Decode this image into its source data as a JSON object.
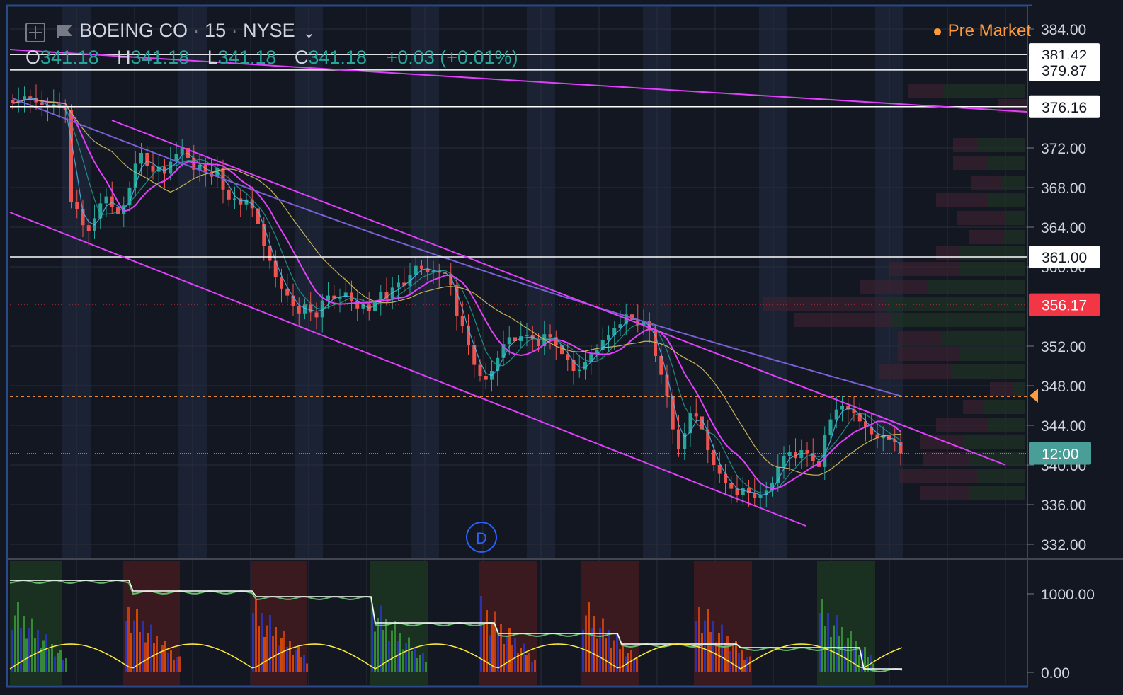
{
  "header": {
    "symbol": "BOEING CO",
    "interval": "15",
    "exchange": "NYSE",
    "session_label": "Pre Market"
  },
  "ohlc": {
    "o_label": "O",
    "o": "341.18",
    "h_label": "H",
    "h": "341.18",
    "l_label": "L",
    "l": "341.18",
    "c_label": "C",
    "c": "341.18",
    "change": "+0.03 (+0.01%)"
  },
  "price_scale": {
    "ticks": [
      "384.00",
      "372.00",
      "368.00",
      "364.00",
      "360.00",
      "352.00",
      "348.00",
      "344.00",
      "340.00",
      "336.00",
      "332.00"
    ],
    "labels": [
      {
        "text": "381.42",
        "kind": "level"
      },
      {
        "text": "379.87",
        "kind": "level"
      },
      {
        "text": "376.16",
        "kind": "level"
      },
      {
        "text": "361.00",
        "kind": "level"
      },
      {
        "text": "356.17",
        "kind": "last"
      },
      {
        "text": "12:00",
        "kind": "countdown"
      }
    ]
  },
  "indicator_scale": {
    "ticks": [
      "1000.00",
      "0.00"
    ]
  },
  "event_badge": "D",
  "colors": {
    "background": "#131722",
    "up": "#26a69a",
    "down": "#ef5350",
    "channel": "#e040fb",
    "ma_long": "#7b5fd6",
    "ma_mid": "#c9b35a",
    "level_line": "#ffffff",
    "last_price": "#f23645",
    "countdown": "#4a9e98",
    "premarket": "#ff9b3d"
  },
  "chart_data": {
    "type": "candlestick",
    "title": "BOEING CO · 15 · NYSE",
    "ylim": [
      330.0,
      385.0
    ],
    "closes": [
      376.5,
      376.8,
      377.2,
      377.0,
      376.6,
      376.3,
      376.1,
      376.4,
      376.0,
      375.8,
      366.5,
      365.8,
      364.2,
      363.6,
      364.9,
      366.4,
      367.1,
      366.0,
      365.3,
      366.2,
      368.0,
      370.4,
      371.5,
      370.2,
      369.6,
      370.1,
      369.4,
      370.6,
      371.4,
      372.0,
      371.0,
      369.8,
      370.3,
      369.6,
      369.1,
      370.0,
      367.8,
      366.8,
      366.9,
      366.3,
      366.8,
      365.9,
      364.3,
      362.1,
      360.6,
      359.0,
      357.8,
      357.1,
      356.0,
      355.3,
      356.2,
      355.4,
      354.9,
      356.6,
      357.1,
      356.8,
      357.0,
      357.4,
      356.5,
      355.8,
      356.2,
      355.5,
      356.6,
      357.5,
      356.8,
      357.9,
      358.4,
      358.1,
      359.2,
      360.1,
      359.8,
      359.5,
      359.6,
      359.4,
      359.3,
      358.2,
      355.0,
      354.0,
      352.1,
      350.1,
      349.0,
      348.6,
      349.5,
      350.8,
      352.2,
      352.9,
      352.5,
      353.0,
      353.1,
      352.7,
      352.0,
      353.2,
      352.9,
      352.1,
      351.2,
      350.6,
      349.5,
      349.6,
      350.4,
      351.2,
      351.6,
      352.6,
      353.1,
      353.8,
      354.2,
      355.2,
      354.7,
      354.1,
      354.5,
      353.6,
      351.0,
      349.1,
      347.0,
      343.6,
      341.6,
      343.2,
      345.2,
      344.9,
      343.6,
      341.5,
      340.0,
      339.1,
      338.2,
      337.6,
      337.0,
      337.7,
      337.2,
      336.7,
      337.0,
      337.4,
      338.2,
      339.8,
      340.9,
      341.3,
      340.7,
      341.5,
      341.2,
      340.4,
      339.8,
      343.0,
      344.6,
      345.6,
      346.0,
      345.6,
      345.2,
      344.4,
      343.8,
      343.1,
      342.7,
      343.0,
      342.5,
      342.3,
      341.18
    ],
    "volume_profile": "right-aligned",
    "channel_lines": 3,
    "levels": [
      381.42,
      379.87,
      376.16,
      361.0
    ],
    "last_price": 356.17,
    "indicator": {
      "ylim": [
        0,
        1000
      ],
      "range_label": "1000.00"
    }
  }
}
